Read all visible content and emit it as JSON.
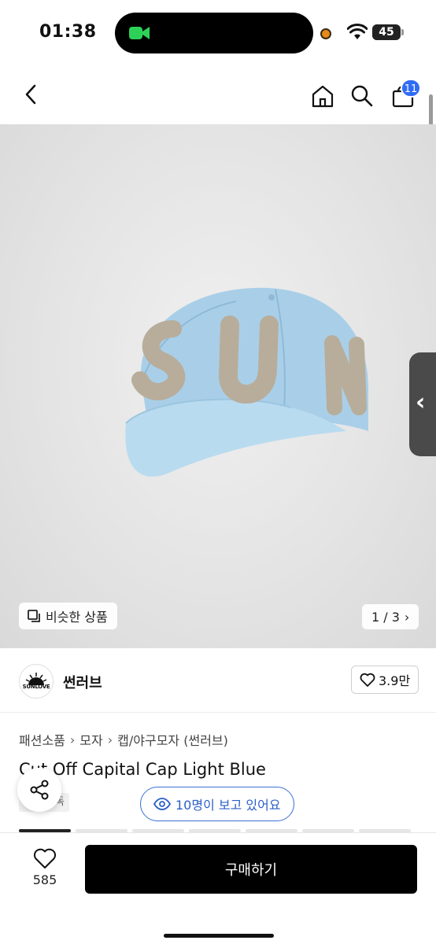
{
  "status_bar": {
    "time": "01:38",
    "battery": "45",
    "battery_level": 0.45
  },
  "nav": {
    "cart_count": "11"
  },
  "hero": {
    "similar_label": "비슷한 상품",
    "pager": "1 / 3",
    "cap_text": "SUN"
  },
  "shop": {
    "logo_text": "SUNLOVE",
    "name": "썬러브",
    "like_count": "3.9만"
  },
  "product": {
    "breadcrumb": [
      "패션소품",
      "모자",
      "캡/야구모자 (썬러브)"
    ],
    "title": "Cut Off Capital Cap Light Blue",
    "tag": "단독",
    "viewers": "10명이 보고 있어요"
  },
  "bottom": {
    "wish_count": "585",
    "buy_label": "구매하기"
  }
}
